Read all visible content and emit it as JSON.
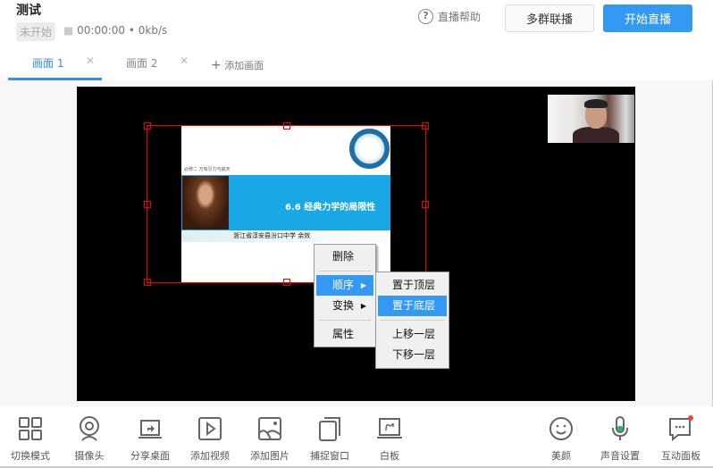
{
  "header": {
    "title": "测试",
    "status": "未开始",
    "timer": "00:00:00",
    "bitrate": "0kb/s",
    "help": "直播帮助",
    "multi_button": "多群联播",
    "start_button": "开始直播"
  },
  "tabs": [
    {
      "label": "画面 1",
      "active": true
    },
    {
      "label": "画面 2",
      "active": false
    }
  ],
  "add_tab": "添加画面",
  "slide": {
    "title": "6.6 经典力学的局限性",
    "subtitle": "浙江省淳安县汾口中学        余效",
    "small_text": "必修二  万有引力与航天"
  },
  "context_menu": {
    "items": [
      "删除",
      "顺序",
      "变换",
      "属性"
    ],
    "highlighted": "顺序"
  },
  "submenu": {
    "items": [
      "置于顶层",
      "置于底层",
      "上移一层",
      "下移一层"
    ],
    "highlighted": "置于底层"
  },
  "toolbar": {
    "left": [
      {
        "label": "切换模式",
        "icon": "grid-icon"
      },
      {
        "label": "摄像头",
        "icon": "camera-icon"
      },
      {
        "label": "分享桌面",
        "icon": "share-screen-icon"
      },
      {
        "label": "添加视频",
        "icon": "video-icon"
      },
      {
        "label": "添加图片",
        "icon": "image-icon"
      },
      {
        "label": "捕捉窗口",
        "icon": "window-capture-icon"
      },
      {
        "label": "白板",
        "icon": "whiteboard-icon"
      }
    ],
    "right": [
      {
        "label": "美颜",
        "icon": "smile-icon"
      },
      {
        "label": "声音设置",
        "icon": "microphone-icon"
      },
      {
        "label": "互动面板",
        "icon": "chat-icon"
      }
    ]
  },
  "colors": {
    "accent": "#3399f3",
    "selection": "#e00000",
    "notification": "#e54545"
  }
}
